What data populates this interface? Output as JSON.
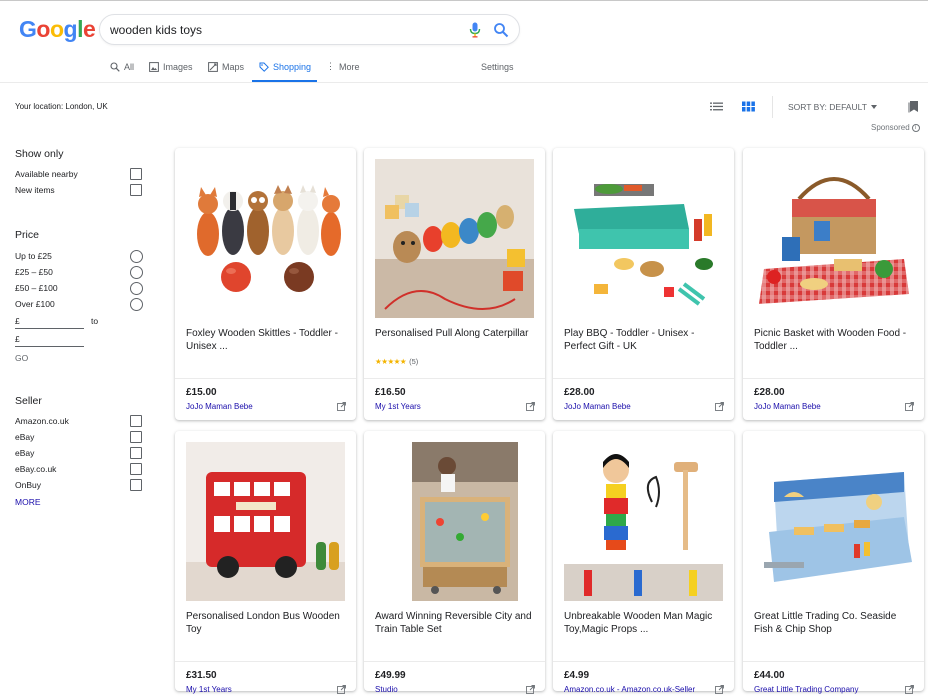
{
  "header": {
    "logo_text": "Google",
    "search_value": "wooden kids toys"
  },
  "tabs": [
    {
      "label": "All",
      "icon": "search-icon"
    },
    {
      "label": "Images",
      "icon": "image-icon"
    },
    {
      "label": "Maps",
      "icon": "map-icon"
    },
    {
      "label": "Shopping",
      "icon": "tag-icon",
      "active": true
    },
    {
      "label": "More",
      "icon": "more-vert-icon"
    }
  ],
  "settings_label": "Settings",
  "location": "Your location: London, UK",
  "sort": {
    "label": "SORT BY: DEFAULT"
  },
  "sponsored": "Sponsored",
  "sidebar": {
    "show_only": {
      "heading": "Show only",
      "options": [
        "Available nearby",
        "New items"
      ]
    },
    "price": {
      "heading": "Price",
      "options": [
        "Up to £25",
        "£25 – £50",
        "£50 – £100",
        "Over £100"
      ],
      "min_prefix": "£",
      "to_label": "to",
      "max_prefix": "£",
      "go_label": "GO"
    },
    "seller": {
      "heading": "Seller",
      "options": [
        "Amazon.co.uk",
        "eBay",
        "eBay",
        "eBay.co.uk",
        "OnBuy"
      ],
      "more_label": "MORE"
    }
  },
  "products": [
    {
      "title": "Foxley Wooden Skittles - Toddler - Unisex ...",
      "price": "£15.00",
      "seller": "JoJo Maman Bebe"
    },
    {
      "title": "Personalised Pull Along Caterpillar",
      "price": "£16.50",
      "seller": "My 1st Years",
      "rating_stars": "★★★★★",
      "rating_count": "(5)"
    },
    {
      "title": "Play BBQ - Toddler - Unisex - Perfect Gift - UK",
      "price": "£28.00",
      "seller": "JoJo Maman Bebe"
    },
    {
      "title": "Picnic Basket with Wooden Food - Toddler ...",
      "price": "£28.00",
      "seller": "JoJo Maman Bebe"
    },
    {
      "title": "Personalised London Bus Wooden Toy",
      "price": "£31.50",
      "seller": "My 1st Years"
    },
    {
      "title": "Award Winning Reversible City and Train Table Set",
      "price": "£49.99",
      "seller": "Studio"
    },
    {
      "title": "Unbreakable Wooden Man Magic Toy,Magic Props ...",
      "price": "£4.99",
      "seller": "Amazon.co.uk - Amazon.co.uk-Seller"
    },
    {
      "title": "Great Little Trading Co. Seaside Fish & Chip Shop",
      "price": "£44.00",
      "seller": "Great Little Trading Company"
    }
  ],
  "colors": {
    "link": "#1a0dab",
    "accent": "#1a73e8",
    "star": "#f4b400"
  }
}
